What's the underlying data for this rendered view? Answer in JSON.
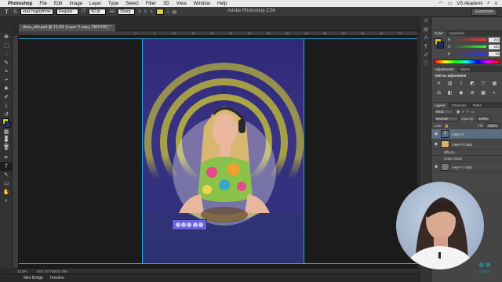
{
  "menubar": {
    "app_name": "Photoshop",
    "items": [
      "File",
      "Edit",
      "Image",
      "Layer",
      "Type",
      "Select",
      "Filter",
      "3D",
      "View",
      "Window",
      "Help"
    ],
    "user": "VS Akademi"
  },
  "options": {
    "font_family": "eraz hugoytnme",
    "font_style": "Regular",
    "font_size": "60 pt",
    "antialias": "Sharp",
    "window_title": "Adobe Photoshop CS6",
    "workspace": "Essentials"
  },
  "document": {
    "tab_title": "dirsa_afiri.psd @ 12,4% (Layer 0 copy, CMYK/8*) *",
    "ruler_ticks": [
      "0",
      "5",
      "10",
      "15",
      "20",
      "25",
      "30",
      "35",
      "40",
      "45",
      "50",
      "55",
      "60",
      "65",
      "70",
      "75",
      "80",
      "85",
      "90",
      "95",
      "100",
      "105",
      "110",
      "115",
      "120",
      "125"
    ]
  },
  "status": {
    "zoom": "12,5%",
    "doc": "Doc: 97,7M/213,9M"
  },
  "bottom_tabs": [
    "Mini Bridge",
    "Timeline"
  ],
  "color_panel": {
    "tabs": [
      "Color",
      "Swatches"
    ],
    "channels": [
      {
        "label": "R",
        "value": "204",
        "gradient": "#9a0000"
      },
      {
        "label": "G",
        "value": "181",
        "gradient": "#005a00"
      },
      {
        "label": "B",
        "value": "33",
        "gradient": "#00009a"
      }
    ]
  },
  "adjustments_panel": {
    "tabs": [
      "Adjustments",
      "Styles"
    ],
    "title": "Add an adjustment",
    "icons": [
      "brightness-icon",
      "levels-icon",
      "curves-icon",
      "exposure-icon",
      "vibrance-icon",
      "hue-icon",
      "balance-icon",
      "bw-icon",
      "photo-filter-icon",
      "mixer-icon",
      "lookup-icon",
      "invert-icon"
    ]
  },
  "layers_panel": {
    "tabs": [
      "Layers",
      "Channels",
      "Paths"
    ],
    "kind": "Kind",
    "blend": "Normal",
    "opacity_label": "Opacity:",
    "opacity": "100%",
    "lock_label": "Lock:",
    "fill_label": "Fill:",
    "fill": "100%",
    "layers": [
      {
        "name": "Layer 2",
        "selected": true,
        "type": "text"
      },
      {
        "name": "Layer 0 copy",
        "selected": false,
        "type": "image"
      },
      {
        "name": "Effects",
        "selected": false,
        "type": "sub"
      },
      {
        "name": "Outer Glow",
        "selected": false,
        "type": "sub"
      },
      {
        "name": "Layer 1 copy",
        "selected": false,
        "type": "image"
      }
    ]
  },
  "watermark": "Udemy"
}
